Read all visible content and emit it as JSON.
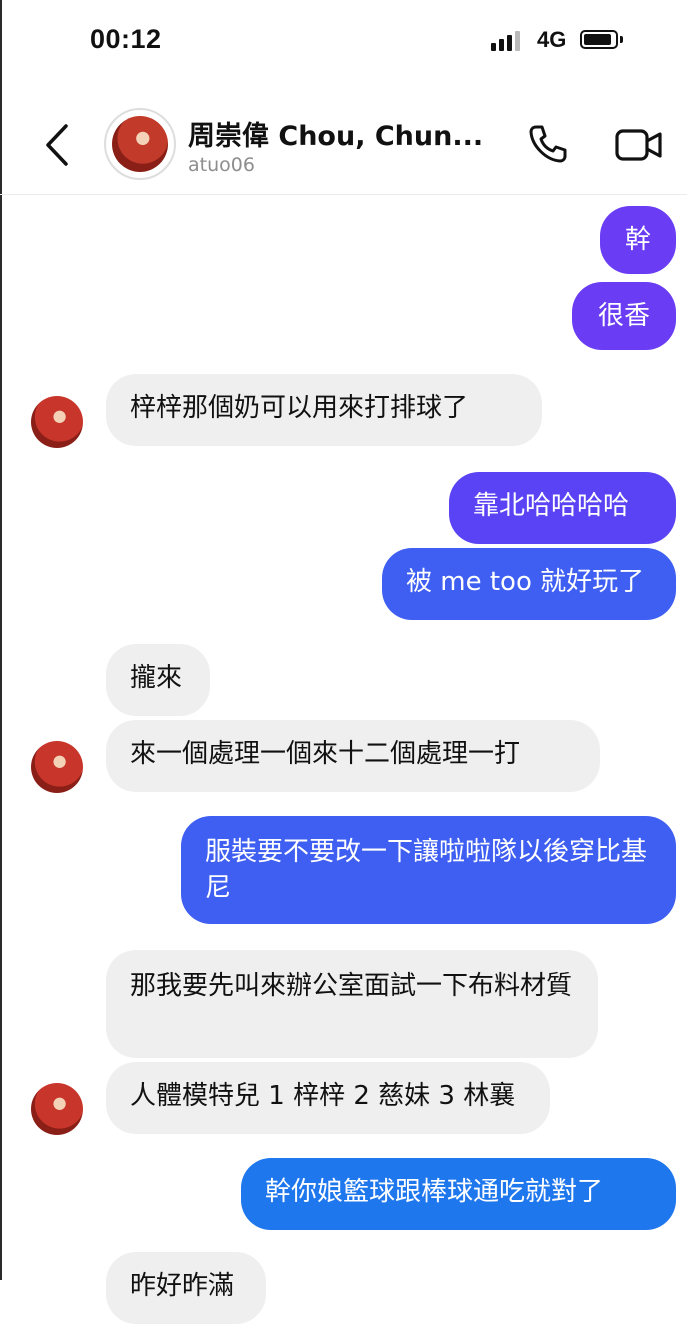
{
  "status": {
    "time": "00:12",
    "network": "4G"
  },
  "header": {
    "contact_name": "周崇偉 Chou, Chun...",
    "contact_handle": "atuo06"
  },
  "icons": {
    "back": "chevron-left-icon",
    "call": "phone-icon",
    "video": "video-camera-icon"
  },
  "colors": {
    "outgoing_purple": "#6a3df5",
    "outgoing_blue": "#3f5ff2",
    "outgoing_blue2": "#1f77ee",
    "incoming_gray": "#efefef"
  },
  "messages": [
    {
      "dir": "out",
      "text": "幹"
    },
    {
      "dir": "out",
      "text": "很香"
    },
    {
      "dir": "in",
      "text": "梓梓那個奶可以用來打排球了"
    },
    {
      "dir": "out",
      "text": "靠北哈哈哈哈"
    },
    {
      "dir": "out",
      "text": "被 me too 就好玩了"
    },
    {
      "dir": "in",
      "text": "攏來"
    },
    {
      "dir": "in",
      "text": "來一個處理一個來十二個處理一打"
    },
    {
      "dir": "out",
      "text": "服裝要不要改一下讓啦啦隊以後穿比基尼"
    },
    {
      "dir": "in",
      "text": "那我要先叫來辦公室面試一下布料材質"
    },
    {
      "dir": "in",
      "text": "人體模特兒 1 梓梓 2 慈妹 3 林襄"
    },
    {
      "dir": "out",
      "text": "幹你娘籃球跟棒球通吃就對了"
    },
    {
      "dir": "in",
      "text": "昨好昨滿"
    }
  ]
}
